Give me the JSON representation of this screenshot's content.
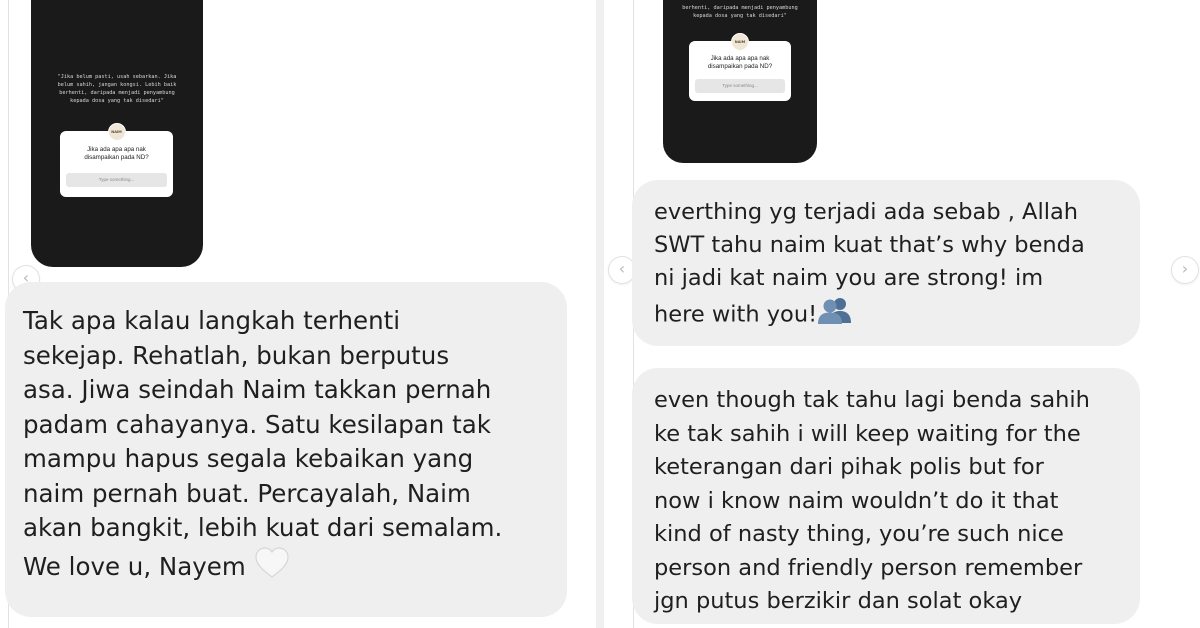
{
  "left_panel": {
    "story_card": {
      "quote": "\"Jika belum pasti, usah sebarkan. Jika\nbelum sahih, jangan kongsi. Lebih baik\nberhenti, daripada menjadi penyambung\nkepada dosa yang tak disedari\"",
      "avatar_text": "NAIM",
      "question": "Jika ada apa apa nak\ndisampaikan pada ND?",
      "answer_placeholder": "Type something..."
    },
    "prev_icon": "‹",
    "message": "Tak apa kalau langkah terhenti\nsekejap. Rehatlah, bukan berputus\nasa. Jiwa seindah Naim takkan pernah\npadam cahayanya. Satu kesilapan tak\nmampu hapus segala kebaikan yang\nnaim pernah buat. Percayalah, Naim\nakan bangkit, lebih kuat dari semalam.\nWe love u, Nayem",
    "message_emoji": "white-heart-icon"
  },
  "right_panel": {
    "story_card": {
      "quote": "berhenti, daripada menjadi penyambung\nkepada dosa yang tak disedari\"",
      "avatar_text": "NAIM",
      "question": "Jika ada apa apa nak\ndisampaikan pada ND?",
      "answer_placeholder": "Type something..."
    },
    "prev_icon": "‹",
    "next_icon": "›",
    "message_1": "everthing yg terjadi ada sebab , Allah\nSWT tahu naim kuat that’s why benda\nni jadi kat naim you are strong! im\nhere with you!",
    "message_1_emoji": "busts-in-silhouette-icon",
    "message_2": "even though tak tahu lagi benda sahih\nke tak sahih i will keep waiting for the\nketerangan dari pihak polis but for\nnow i know naim wouldn’t do it that\nkind of nasty thing, you’re such nice\nperson and friendly person remember\njgn putus berzikir dan solat okay"
  },
  "colors": {
    "bubble_bg": "#efefef",
    "story_bg": "#1a1a1a",
    "text": "#1f1f1f",
    "emoji_blue": "#5b7fa6"
  }
}
